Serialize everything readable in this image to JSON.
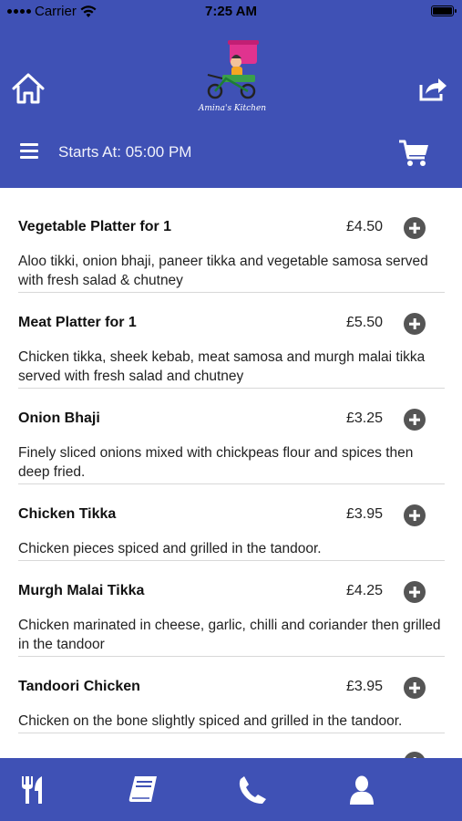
{
  "status_bar": {
    "carrier": "Carrier",
    "time": "7:25 AM"
  },
  "header": {
    "logo_text": "Amina's Kitchen",
    "starts_at": "Starts At: 05:00 PM",
    "accent_color": "#3f51b5"
  },
  "menu_items": [
    {
      "name": "Vegetable Platter for 1",
      "price": "£4.50",
      "description": "Aloo tikki, onion bhaji, paneer tikka and vegetable samosa served with fresh salad & chutney"
    },
    {
      "name": "Meat Platter for 1",
      "price": "£5.50",
      "description": "Chicken tikka, sheek kebab, meat samosa and murgh malai tikka served with fresh salad and chutney"
    },
    {
      "name": "Onion Bhaji",
      "price": "£3.25",
      "description": "Finely sliced onions mixed with chickpeas flour and spices then deep fried."
    },
    {
      "name": "Chicken Tikka",
      "price": "£3.95",
      "description": "Chicken pieces spiced and grilled in the tandoor."
    },
    {
      "name": "Murgh Malai Tikka",
      "price": "£4.25",
      "description": "Chicken marinated in cheese, garlic, chilli and coriander then grilled in the tandoor"
    },
    {
      "name": "Tandoori Chicken",
      "price": "£3.95",
      "description": "Chicken on the bone slightly spiced and grilled in the tandoor."
    }
  ],
  "tabbar": {
    "icons": [
      "cutlery-icon",
      "book-icon",
      "phone-icon",
      "user-icon"
    ]
  }
}
